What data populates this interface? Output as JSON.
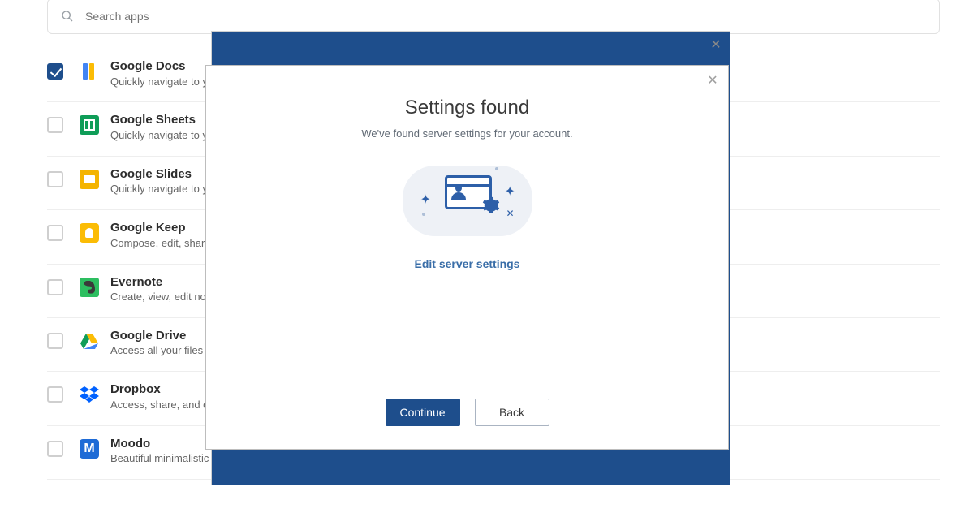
{
  "search": {
    "placeholder": "Search apps"
  },
  "apps": [
    {
      "name": "Google Docs",
      "desc": "Quickly navigate to your documents",
      "checked": true,
      "icon": "docs"
    },
    {
      "name": "Google Sheets",
      "desc": "Quickly navigate to your spreadsheets",
      "checked": false,
      "icon": "sheets"
    },
    {
      "name": "Google Slides",
      "desc": "Quickly navigate to your presentations",
      "checked": false,
      "icon": "slides"
    },
    {
      "name": "Google Keep",
      "desc": "Compose, edit, share notes",
      "checked": false,
      "icon": "keep"
    },
    {
      "name": "Evernote",
      "desc": "Create, view, edit notes",
      "checked": false,
      "icon": "evernote"
    },
    {
      "name": "Google Drive",
      "desc": "Access all your files in Drive",
      "checked": false,
      "icon": "drive"
    },
    {
      "name": "Dropbox",
      "desc": "Access, share, and organize files",
      "checked": false,
      "icon": "dropbox"
    },
    {
      "name": "Moodo",
      "desc": "Beautiful minimalistic to-do list",
      "checked": false,
      "icon": "moodo"
    }
  ],
  "modal": {
    "title": "Settings found",
    "subtitle": "We've found server settings for your account.",
    "edit_link": "Edit server settings",
    "continue_label": "Continue",
    "back_label": "Back"
  }
}
